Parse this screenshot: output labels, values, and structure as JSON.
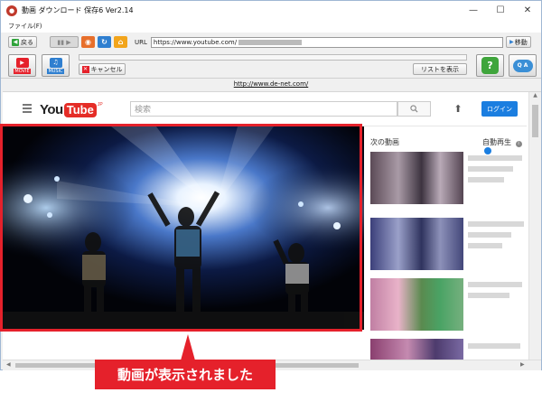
{
  "window": {
    "title": "動画 ダウンロード 保存6 Ver2.14",
    "minimize": "—",
    "maximize": "☐",
    "close": "✕"
  },
  "menu": {
    "file": "ファイル(F)"
  },
  "toolbar": {
    "back_label": "戻る",
    "url_label": "URL",
    "url_value": "https://www.youtube.com/",
    "go_label": "移動"
  },
  "toolbar2": {
    "movie_label": "MOVIE",
    "music_label": "MUSIC",
    "cancel_label": "キャンセル",
    "list_label": "リストを表示",
    "help_label": "?",
    "qa_label": "Q A"
  },
  "link_url": "http://www.de-net.com/",
  "youtube": {
    "logo_you": "You",
    "logo_tube": "Tube",
    "logo_region": "JP",
    "search_placeholder": "検索",
    "login_label": "ログイン",
    "next_videos_label": "次の動画",
    "autoplay_label": "自動再生"
  },
  "callout": {
    "text": "動画が表示されました"
  },
  "colors": {
    "accent_red": "#e5212b",
    "youtube_blue": "#1b7ee0"
  }
}
